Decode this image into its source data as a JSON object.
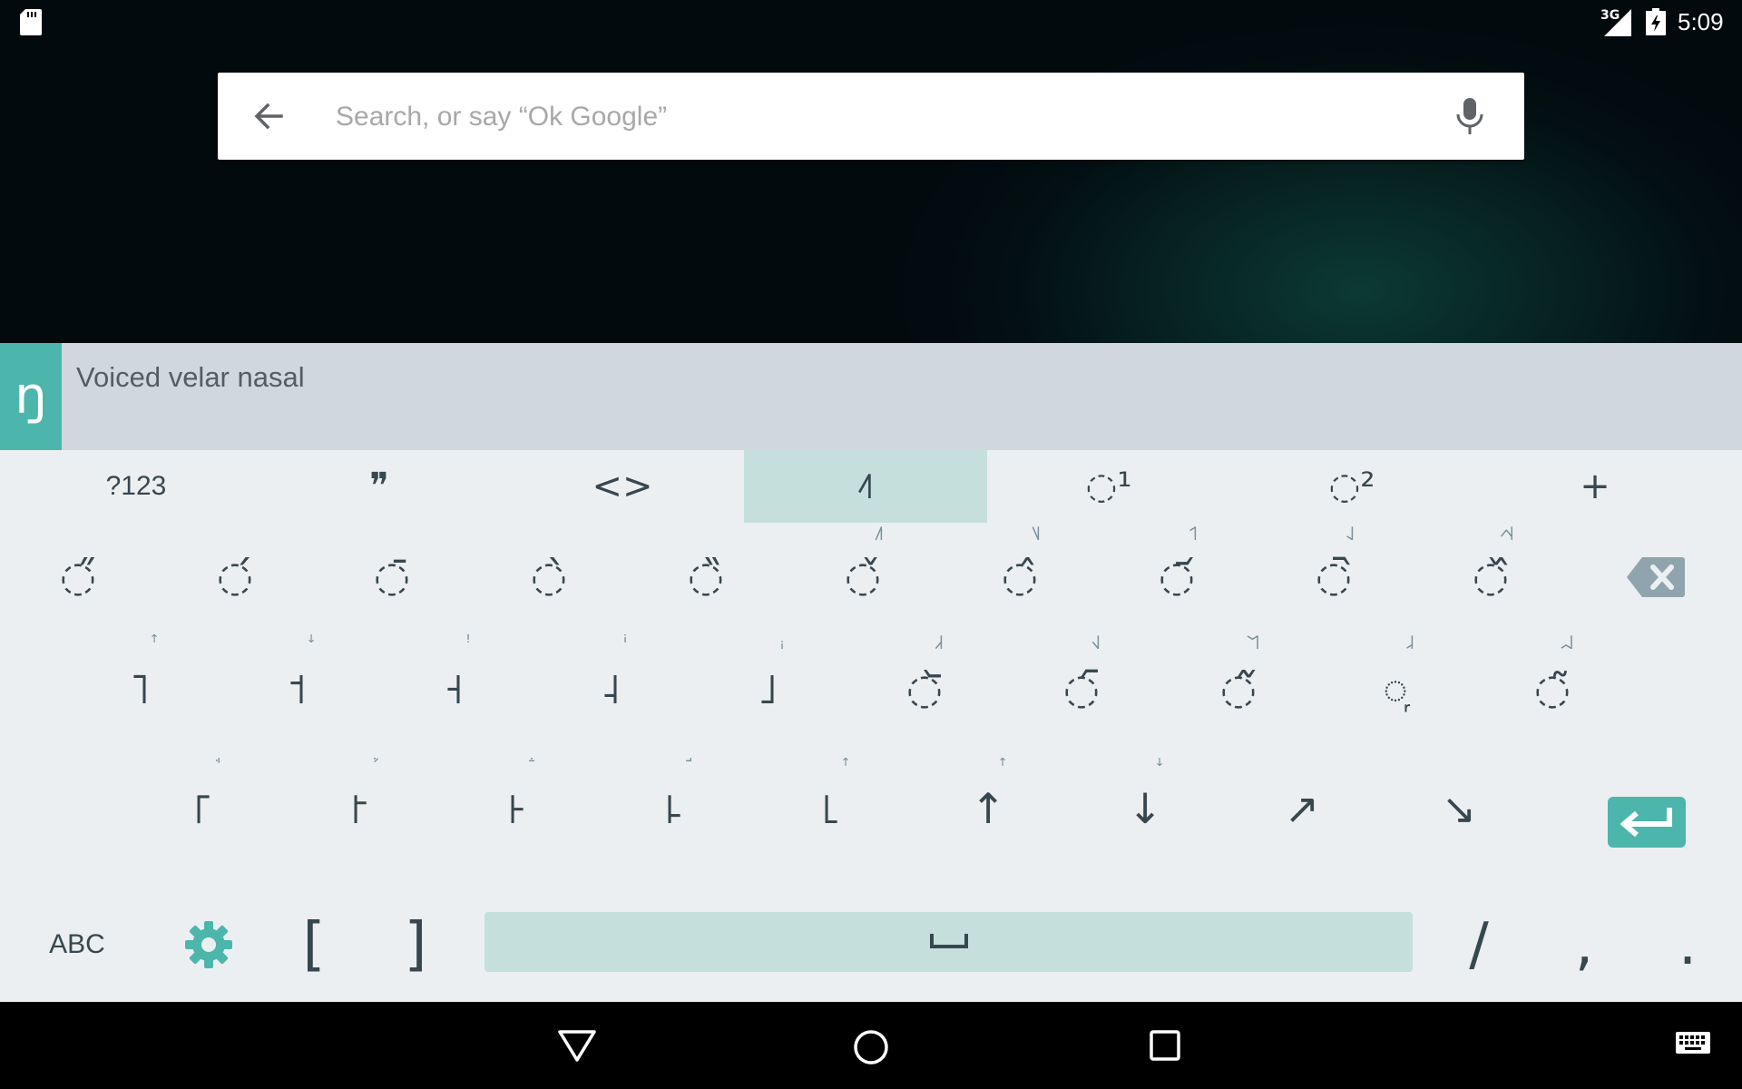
{
  "status_bar": {
    "time": "5:09",
    "network": "3G",
    "icons": [
      "sd-card-icon",
      "signal-icon",
      "battery-charging-icon"
    ]
  },
  "search": {
    "placeholder": "Search, or say “Ok Google”",
    "value": ""
  },
  "suggestion": {
    "preview_char": "ŋ",
    "description": "Voiced velar nasal"
  },
  "tabs": [
    {
      "label": "?123",
      "active": false
    },
    {
      "label": "❞",
      "active": false
    },
    {
      "label": "<>",
      "active": false
    },
    {
      "label": "˨˥",
      "active": true
    },
    {
      "label": "◌¹",
      "active": false
    },
    {
      "label": "◌²",
      "active": false
    },
    {
      "label": "+",
      "active": false
    }
  ],
  "rows": [
    [
      {
        "main": "◌̋",
        "hint": ""
      },
      {
        "main": "◌́",
        "hint": ""
      },
      {
        "main": "◌̄",
        "hint": ""
      },
      {
        "main": "◌̀",
        "hint": ""
      },
      {
        "main": "◌̏",
        "hint": ""
      },
      {
        "main": "◌̌",
        "hint": "˩˥"
      },
      {
        "main": "◌̂",
        "hint": "˥˩"
      },
      {
        "main": "◌᷄",
        "hint": "˦˥"
      },
      {
        "main": "◌᷆",
        "hint": "˨˩"
      },
      {
        "main": "◌᷈",
        "hint": "˨˦˨"
      }
    ],
    [
      {
        "main": "˥",
        "hint": "ꜛ"
      },
      {
        "main": "˦",
        "hint": "ꜜ"
      },
      {
        "main": "˧",
        "hint": "ꜝ"
      },
      {
        "main": "˨",
        "hint": "ꜞ"
      },
      {
        "main": "˩",
        "hint": "ꜟ"
      },
      {
        "main": "◌᷅",
        "hint": "˩˧"
      },
      {
        "main": "◌᷇",
        "hint": "˧˩"
      },
      {
        "main": "◌᷉",
        "hint": "˥˦˥"
      },
      {
        "main": "◌᷊",
        "hint": "˩˨"
      },
      {
        "main": "◌̃",
        "hint": "˩˨˩"
      }
    ],
    [
      {
        "main": "꜒",
        "hint": "ꜗ"
      },
      {
        "main": "꜓",
        "hint": "ꜘ"
      },
      {
        "main": "꜔",
        "hint": "ꜙ"
      },
      {
        "main": "꜕",
        "hint": "ꜚ"
      },
      {
        "main": "꜖",
        "hint": "ꜛ"
      },
      {
        "main": "↑",
        "hint": "ꜛ"
      },
      {
        "main": "↓",
        "hint": "ꜜ"
      },
      {
        "main": "↗",
        "hint": ""
      },
      {
        "main": "↘",
        "hint": ""
      }
    ]
  ],
  "bottom_row": {
    "abc_label": "ABC",
    "open_bracket": "[",
    "close_bracket": "]",
    "slash": "/",
    "comma": ",",
    "period": "."
  },
  "colors": {
    "accent": "#4db6ac",
    "active_tab": "#c5dfdd",
    "keyboard_bg": "#eceff1",
    "key_text": "#37474f"
  }
}
